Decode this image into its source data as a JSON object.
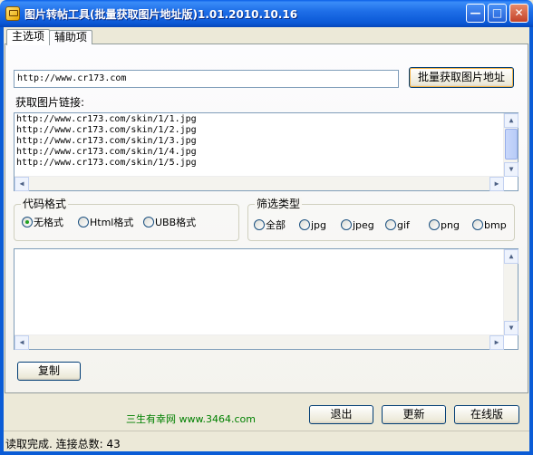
{
  "window": {
    "title": "图片转帖工具(批量获取图片地址版)1.01.2010.10.16",
    "controls": {
      "minimize": "—",
      "maximize": "□",
      "close": "✕"
    }
  },
  "tabs": [
    {
      "label": "主选项",
      "active": true
    },
    {
      "label": "辅助项",
      "active": false
    }
  ],
  "url_input": {
    "value": "http://www.cr173.com"
  },
  "fetch_button": {
    "label": "批量获取图片地址"
  },
  "links": {
    "label": "获取图片链接:",
    "items": [
      "http://www.cr173.com/skin/1/1.jpg",
      "http://www.cr173.com/skin/1/2.jpg",
      "http://www.cr173.com/skin/1/3.jpg",
      "http://www.cr173.com/skin/1/4.jpg",
      "http://www.cr173.com/skin/1/5.jpg"
    ]
  },
  "code_format": {
    "title": "代码格式",
    "options": [
      {
        "label": "无格式",
        "selected": true
      },
      {
        "label": "Html格式",
        "selected": false
      },
      {
        "label": "UBB格式",
        "selected": false
      }
    ]
  },
  "filter_type": {
    "title": "筛选类型",
    "options": [
      {
        "label": "全部",
        "selected": false
      },
      {
        "label": "jpg",
        "selected": false
      },
      {
        "label": "jpeg",
        "selected": false
      },
      {
        "label": "gif",
        "selected": false
      },
      {
        "label": "png",
        "selected": false
      },
      {
        "label": "bmp",
        "selected": false
      }
    ]
  },
  "copy_button": {
    "label": "复制"
  },
  "footer": {
    "site": "三生有幸网 www.3464.com",
    "exit_label": "退出",
    "update_label": "更新",
    "online_label": "在线版"
  },
  "status": {
    "text": "读取完成. 连接总数: 43"
  },
  "colors": {
    "titlebar": "#0a58d6",
    "site_link": "#008000",
    "window_bg": "#ece9d8"
  }
}
